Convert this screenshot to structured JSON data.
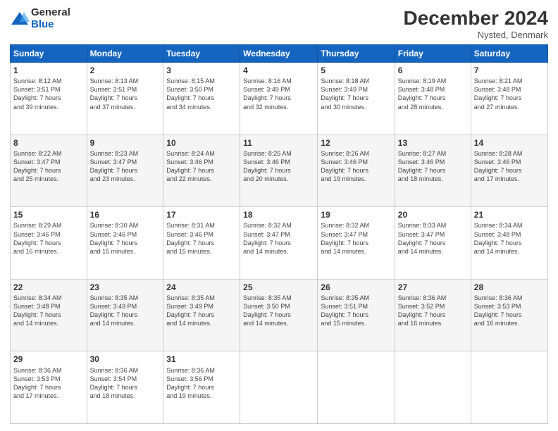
{
  "logo": {
    "general": "General",
    "blue": "Blue"
  },
  "header": {
    "month": "December 2024",
    "location": "Nysted, Denmark"
  },
  "columns": [
    "Sunday",
    "Monday",
    "Tuesday",
    "Wednesday",
    "Thursday",
    "Friday",
    "Saturday"
  ],
  "weeks": [
    [
      {
        "day": "1",
        "detail": "Sunrise: 8:12 AM\nSunset: 3:51 PM\nDaylight: 7 hours\nand 39 minutes."
      },
      {
        "day": "2",
        "detail": "Sunrise: 8:13 AM\nSunset: 3:51 PM\nDaylight: 7 hours\nand 37 minutes."
      },
      {
        "day": "3",
        "detail": "Sunrise: 8:15 AM\nSunset: 3:50 PM\nDaylight: 7 hours\nand 34 minutes."
      },
      {
        "day": "4",
        "detail": "Sunrise: 8:16 AM\nSunset: 3:49 PM\nDaylight: 7 hours\nand 32 minutes."
      },
      {
        "day": "5",
        "detail": "Sunrise: 8:18 AM\nSunset: 3:49 PM\nDaylight: 7 hours\nand 30 minutes."
      },
      {
        "day": "6",
        "detail": "Sunrise: 8:19 AM\nSunset: 3:48 PM\nDaylight: 7 hours\nand 28 minutes."
      },
      {
        "day": "7",
        "detail": "Sunrise: 8:21 AM\nSunset: 3:48 PM\nDaylight: 7 hours\nand 27 minutes."
      }
    ],
    [
      {
        "day": "8",
        "detail": "Sunrise: 8:22 AM\nSunset: 3:47 PM\nDaylight: 7 hours\nand 25 minutes."
      },
      {
        "day": "9",
        "detail": "Sunrise: 8:23 AM\nSunset: 3:47 PM\nDaylight: 7 hours\nand 23 minutes."
      },
      {
        "day": "10",
        "detail": "Sunrise: 8:24 AM\nSunset: 3:46 PM\nDaylight: 7 hours\nand 22 minutes."
      },
      {
        "day": "11",
        "detail": "Sunrise: 8:25 AM\nSunset: 3:46 PM\nDaylight: 7 hours\nand 20 minutes."
      },
      {
        "day": "12",
        "detail": "Sunrise: 8:26 AM\nSunset: 3:46 PM\nDaylight: 7 hours\nand 19 minutes."
      },
      {
        "day": "13",
        "detail": "Sunrise: 8:27 AM\nSunset: 3:46 PM\nDaylight: 7 hours\nand 18 minutes."
      },
      {
        "day": "14",
        "detail": "Sunrise: 8:28 AM\nSunset: 3:46 PM\nDaylight: 7 hours\nand 17 minutes."
      }
    ],
    [
      {
        "day": "15",
        "detail": "Sunrise: 8:29 AM\nSunset: 3:46 PM\nDaylight: 7 hours\nand 16 minutes."
      },
      {
        "day": "16",
        "detail": "Sunrise: 8:30 AM\nSunset: 3:46 PM\nDaylight: 7 hours\nand 15 minutes."
      },
      {
        "day": "17",
        "detail": "Sunrise: 8:31 AM\nSunset: 3:46 PM\nDaylight: 7 hours\nand 15 minutes."
      },
      {
        "day": "18",
        "detail": "Sunrise: 8:32 AM\nSunset: 3:47 PM\nDaylight: 7 hours\nand 14 minutes."
      },
      {
        "day": "19",
        "detail": "Sunrise: 8:32 AM\nSunset: 3:47 PM\nDaylight: 7 hours\nand 14 minutes."
      },
      {
        "day": "20",
        "detail": "Sunrise: 8:33 AM\nSunset: 3:47 PM\nDaylight: 7 hours\nand 14 minutes."
      },
      {
        "day": "21",
        "detail": "Sunrise: 8:34 AM\nSunset: 3:48 PM\nDaylight: 7 hours\nand 14 minutes."
      }
    ],
    [
      {
        "day": "22",
        "detail": "Sunrise: 8:34 AM\nSunset: 3:48 PM\nDaylight: 7 hours\nand 14 minutes."
      },
      {
        "day": "23",
        "detail": "Sunrise: 8:35 AM\nSunset: 3:49 PM\nDaylight: 7 hours\nand 14 minutes."
      },
      {
        "day": "24",
        "detail": "Sunrise: 8:35 AM\nSunset: 3:49 PM\nDaylight: 7 hours\nand 14 minutes."
      },
      {
        "day": "25",
        "detail": "Sunrise: 8:35 AM\nSunset: 3:50 PM\nDaylight: 7 hours\nand 14 minutes."
      },
      {
        "day": "26",
        "detail": "Sunrise: 8:35 AM\nSunset: 3:51 PM\nDaylight: 7 hours\nand 15 minutes."
      },
      {
        "day": "27",
        "detail": "Sunrise: 8:36 AM\nSunset: 3:52 PM\nDaylight: 7 hours\nand 16 minutes."
      },
      {
        "day": "28",
        "detail": "Sunrise: 8:36 AM\nSunset: 3:53 PM\nDaylight: 7 hours\nand 16 minutes."
      }
    ],
    [
      {
        "day": "29",
        "detail": "Sunrise: 8:36 AM\nSunset: 3:53 PM\nDaylight: 7 hours\nand 17 minutes."
      },
      {
        "day": "30",
        "detail": "Sunrise: 8:36 AM\nSunset: 3:54 PM\nDaylight: 7 hours\nand 18 minutes."
      },
      {
        "day": "31",
        "detail": "Sunrise: 8:36 AM\nSunset: 3:56 PM\nDaylight: 7 hours\nand 19 minutes."
      },
      null,
      null,
      null,
      null
    ]
  ]
}
